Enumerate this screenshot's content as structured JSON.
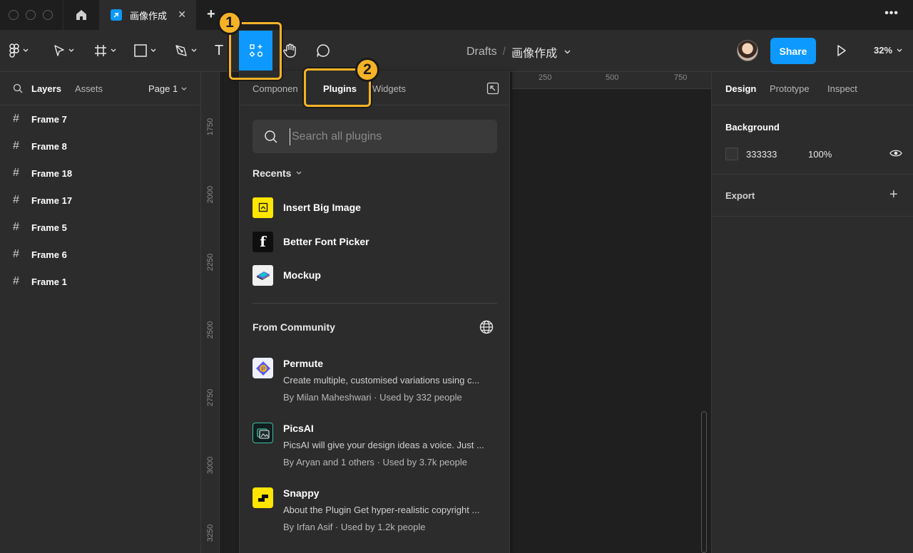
{
  "tabs": {
    "file_tab_title": "画像作成",
    "close_glyph": "✕",
    "add_glyph": "+",
    "more_glyph": "•••"
  },
  "toolbar": {
    "breadcrumb_parent": "Drafts",
    "breadcrumb_sep": "/",
    "file_title": "画像作成",
    "share_label": "Share",
    "zoom": "32%",
    "text_tool_glyph": "T"
  },
  "markers": {
    "step1": "1",
    "step2": "2"
  },
  "left_panel": {
    "tab_layers": "Layers",
    "tab_assets": "Assets",
    "page_selector": "Page 1",
    "layers": [
      "Frame 7",
      "Frame 8",
      "Frame 18",
      "Frame 17",
      "Frame 5",
      "Frame 6",
      "Frame 1"
    ]
  },
  "rulers": {
    "vertical": [
      "1750",
      "2000",
      "2250",
      "2500",
      "2750",
      "3000",
      "3250"
    ],
    "horizontal": [
      "250",
      "500",
      "750"
    ]
  },
  "resources": {
    "tab_components": "Componen",
    "tab_plugins": "Plugins",
    "tab_widgets": "Widgets",
    "search_placeholder": "Search all plugins",
    "recents_title": "Recents",
    "recents": [
      {
        "name": "Insert Big Image",
        "icon": "insert-big-image-icon"
      },
      {
        "name": "Better Font Picker",
        "icon": "better-font-picker-icon"
      },
      {
        "name": "Mockup",
        "icon": "mockup-icon"
      }
    ],
    "community_title": "From Community",
    "community": [
      {
        "name": "Permute",
        "description": "Create multiple, customised variations using c...",
        "by": "By Milan Maheshwari · Used by 332 people",
        "icon": "permute-icon"
      },
      {
        "name": "PicsAI",
        "description": "PicsAI will give your design ideas a voice. Just ...",
        "by": "By Aryan and 1 others · Used by 3.7k people",
        "icon": "picsai-icon"
      },
      {
        "name": "Snappy",
        "description": "About the Plugin Get hyper-realistic copyright ...",
        "by": "By Irfan Asif · Used by 1.2k people",
        "icon": "snappy-icon"
      }
    ]
  },
  "right_panel": {
    "tab_design": "Design",
    "tab_prototype": "Prototype",
    "tab_inspect": "Inspect",
    "background_label": "Background",
    "background_hex": "333333",
    "background_opacity": "100%",
    "export_label": "Export",
    "export_add_glyph": "+"
  },
  "colors": {
    "accent": "#0d99ff",
    "highlight": "#f5b227",
    "panel_bg": "#2c2c2c",
    "canvas_bg": "#1f1f1f"
  }
}
